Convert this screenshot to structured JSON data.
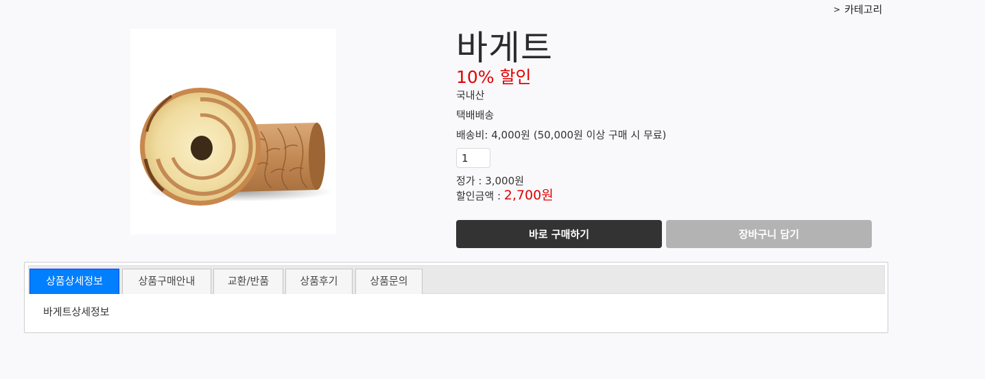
{
  "breadcrumb": {
    "arrow": ">",
    "label": "카테고리"
  },
  "product": {
    "title": "바게트",
    "discount": "10% 할인",
    "origin": "국내산",
    "delivery": "택배배송",
    "shipping": "배송비: 4,000원 (50,000원 이상 구매 시 무료)",
    "quantity": "1",
    "list_price": "정가 : 3,000원",
    "sale_label": "할인금액 : ",
    "sale_price": "2,700원"
  },
  "actions": {
    "buy_label": "바로 구매하기",
    "cart_label": "장바구니 담기"
  },
  "tabs": {
    "items": [
      {
        "label": "상품상세정보"
      },
      {
        "label": "상품구매안내"
      },
      {
        "label": "교환/반품"
      },
      {
        "label": "상품후기"
      },
      {
        "label": "상품문의"
      }
    ],
    "active_index": 0,
    "content": "바게트상세정보"
  },
  "colors": {
    "accent_discount": "#e00000",
    "buy_button": "#333333",
    "cart_button": "#b3b3b3",
    "active_tab": "#007fff"
  }
}
